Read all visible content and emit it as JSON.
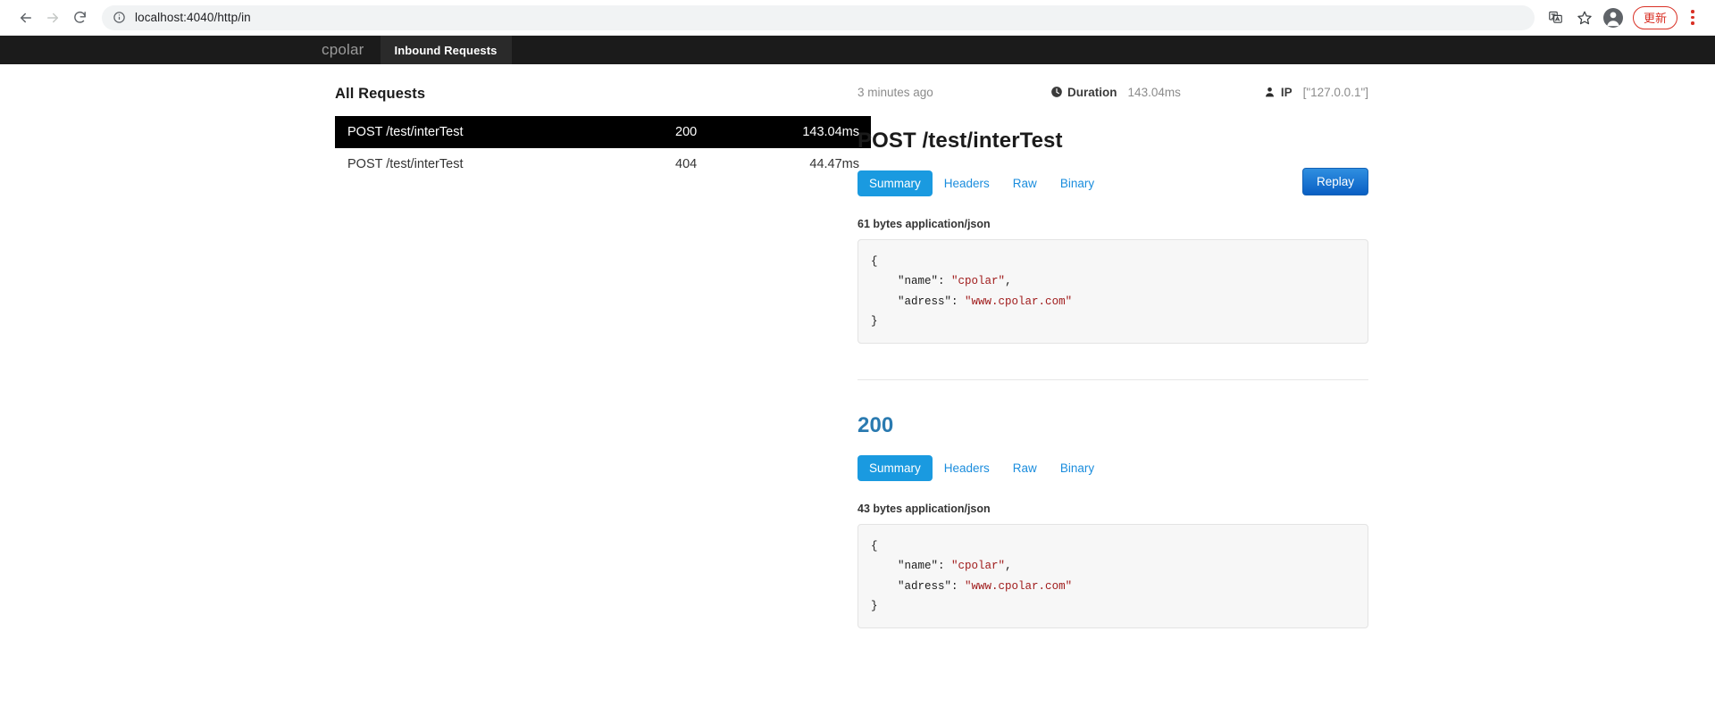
{
  "browser": {
    "url": "localhost:4040/http/in",
    "back_icon": "back-arrow-icon",
    "forward_icon": "forward-arrow-icon",
    "reload_icon": "reload-icon",
    "site_info_icon": "info-circle-icon",
    "translate_icon": "translate-icon",
    "bookmark_icon": "star-icon",
    "profile_icon": "profile-avatar-icon",
    "update_label": "更新",
    "menu_icon": "kebab-menu-icon"
  },
  "app_nav": {
    "brand": "cpolar",
    "tab_label": "Inbound Requests"
  },
  "requests_list": {
    "title": "All Requests",
    "rows": [
      {
        "path": "POST /test/interTest",
        "status": "200",
        "duration": "143.04ms",
        "selected": true
      },
      {
        "path": "POST /test/interTest",
        "status": "404",
        "duration": "44.47ms",
        "selected": false
      }
    ]
  },
  "detail": {
    "meta": {
      "time_ago": "3 minutes ago",
      "duration_icon": "clock-icon",
      "duration_label": "Duration",
      "duration_value": "143.04ms",
      "ip_icon": "person-icon",
      "ip_label": "IP",
      "ip_value": "[\"127.0.0.1\"]"
    },
    "request": {
      "title": "POST /test/interTest",
      "tabs": [
        {
          "label": "Summary",
          "active": true
        },
        {
          "label": "Headers",
          "active": false
        },
        {
          "label": "Raw",
          "active": false
        },
        {
          "label": "Binary",
          "active": false
        }
      ],
      "replay_label": "Replay",
      "bytes_label": "61 bytes application/json",
      "body_lines": [
        {
          "pre": "{",
          "key": "",
          "val": "",
          "post": ""
        },
        {
          "pre": "    ",
          "key": "\"name\"",
          "sep": ": ",
          "val": "\"cpolar\"",
          "post": ","
        },
        {
          "pre": "    ",
          "key": "\"adress\"",
          "sep": ": ",
          "val": "\"www.cpolar.com\"",
          "post": ""
        },
        {
          "pre": "}",
          "key": "",
          "val": "",
          "post": ""
        }
      ]
    },
    "response": {
      "title": "200",
      "tabs": [
        {
          "label": "Summary",
          "active": true
        },
        {
          "label": "Headers",
          "active": false
        },
        {
          "label": "Raw",
          "active": false
        },
        {
          "label": "Binary",
          "active": false
        }
      ],
      "bytes_label": "43 bytes application/json",
      "body_lines": [
        {
          "pre": "{",
          "key": "",
          "val": "",
          "post": ""
        },
        {
          "pre": "    ",
          "key": "\"name\"",
          "sep": ": ",
          "val": "\"cpolar\"",
          "post": ","
        },
        {
          "pre": "    ",
          "key": "\"adress\"",
          "sep": ": ",
          "val": "\"www.cpolar.com\"",
          "post": ""
        },
        {
          "pre": "}",
          "key": "",
          "val": "",
          "post": ""
        }
      ]
    }
  },
  "colors": {
    "accent_blue": "#1a9ae0",
    "link_blue": "#1b8ddd",
    "status_blue": "#2a7ab0",
    "replay_blue": "#0a5fc4",
    "update_red": "#d93025",
    "nav_black": "#1b1b1b",
    "json_string": "#a01c1c"
  }
}
